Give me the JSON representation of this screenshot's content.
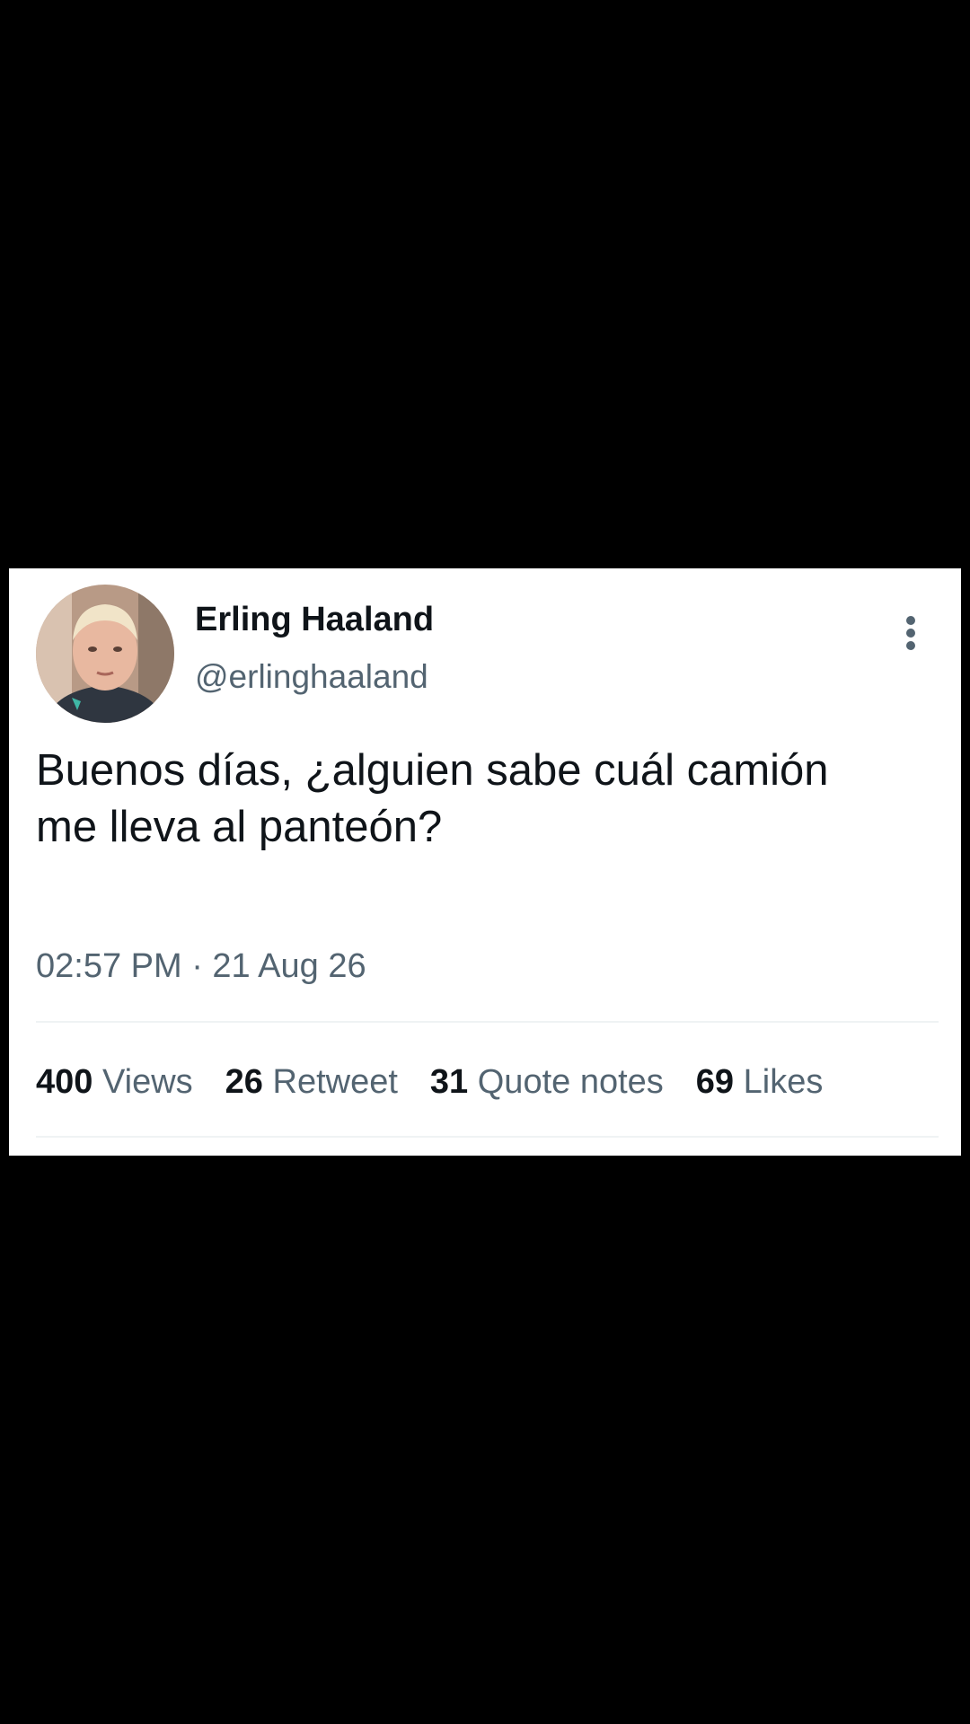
{
  "tweet": {
    "display_name": "Erling Haaland",
    "handle": "@erlinghaaland",
    "text_line1": "Buenos días, ¿alguien sabe cuál camión",
    "text_line2": "me lleva al panteón?",
    "timestamp": "02:57 PM · 21 Aug 26",
    "avatar_icon": "avatar-photo",
    "more_icon": "more-vertical-icon"
  },
  "stats": [
    {
      "value": "400",
      "label": "Views"
    },
    {
      "value": "26",
      "label": "Retweet"
    },
    {
      "value": "31",
      "label": "Quote notes"
    },
    {
      "value": "69",
      "label": "Likes"
    }
  ],
  "colors": {
    "background": "#000000",
    "card": "#ffffff",
    "primary_text": "#0f1419",
    "secondary_text": "#536471",
    "divider": "#eff3f4"
  }
}
